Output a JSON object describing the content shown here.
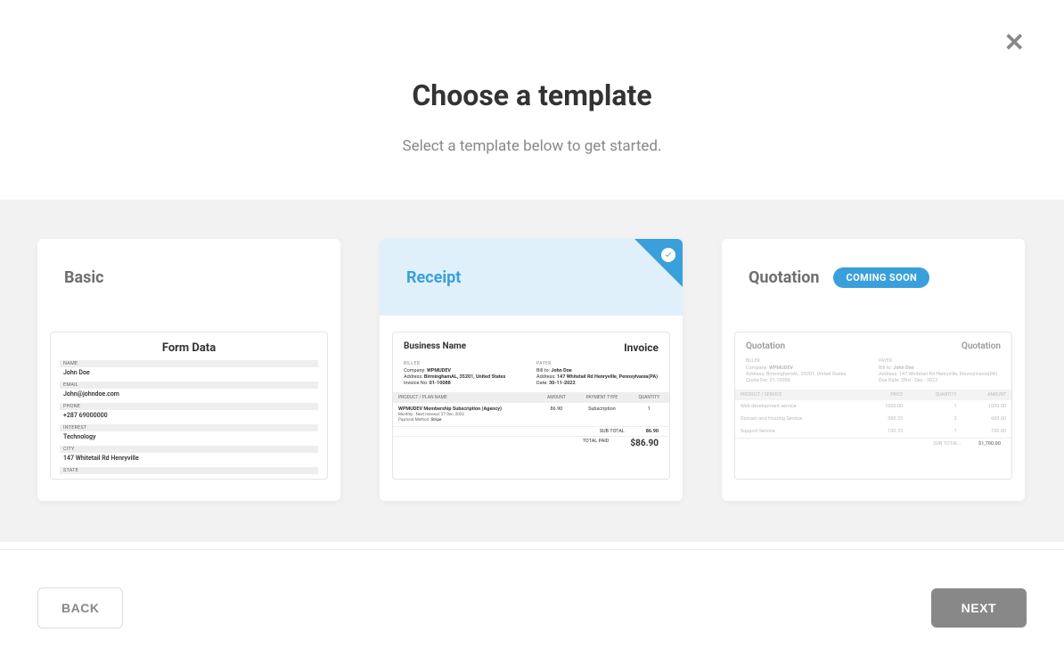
{
  "close": "✕",
  "header": {
    "title": "Choose a template",
    "subtitle": "Select a template below to get started."
  },
  "cards": {
    "basic": {
      "title": "Basic",
      "preview": {
        "heading": "Form Data",
        "fields": [
          {
            "label": "NAME",
            "value": "John Doe"
          },
          {
            "label": "EMAIL",
            "value": "John@johndoe.com"
          },
          {
            "label": "PHONE",
            "value": "+287 69000000"
          },
          {
            "label": "INTEREST",
            "value": "Technology"
          },
          {
            "label": "CITY",
            "value": "147 Whitetail Rd Henryville"
          },
          {
            "label": "STATE",
            "value": ""
          }
        ]
      }
    },
    "receipt": {
      "title": "Receipt",
      "selected": true,
      "preview": {
        "business": "Business Name",
        "invoice_label": "Invoice",
        "biller": {
          "title": "BILLER",
          "company_label": "Company:",
          "company": "WPMUDEV",
          "address_label": "Address:",
          "address": "BirminghamAL, 35201, United States",
          "invoice_no_label": "Invoice No:",
          "invoice_no": "01-10088"
        },
        "payer": {
          "title": "PAYER",
          "bill_to_label": "Bill to:",
          "bill_to": "John Doe",
          "address_label": "Address:",
          "address": "147 Whitetail Rd Henryville, Pennsylvania(PA)",
          "date_label": "Date:",
          "date": "30-11-2022"
        },
        "table": {
          "headers": [
            "PRODUCT / PLAN NAME",
            "AMOUNT",
            "PAYMENT TYPE",
            "QUANTITY"
          ],
          "row": {
            "product": "WPMUDEV Membership Subscription (Agency)",
            "sub1": "Monthly - Next renewal: 27 Dec, 2022",
            "sub2_label": "Payment Method:",
            "sub2_value": "Stripe",
            "amount": "86.90",
            "type": "Subscription",
            "qty": "1"
          }
        },
        "subtotal_label": "SUB TOTAL",
        "subtotal": "86.90",
        "total_label": "TOTAL PAID",
        "total": "$86.90"
      }
    },
    "quotation": {
      "title": "Quotation",
      "badge": "COMING SOON",
      "preview": {
        "left_head": "Quotation",
        "right_head": "Quotation",
        "biller": {
          "title": "BILLER",
          "company_label": "Company:",
          "company": "WPMUDEV",
          "address_label": "Address:",
          "address": "BirminghamAL, 35201, United States",
          "quote_for_label": "Quote For:",
          "quote_for": "01-10088"
        },
        "payer": {
          "title": "PAYER",
          "bill_to_label": "Bill to:",
          "bill_to": "John Doe",
          "address_label": "Address:",
          "address": "147 Whitetail Rd Henryville, Pennsylvania(PA)",
          "due_date_label": "Due Date:",
          "due_date": "28rd - Dec - 2022"
        },
        "table": {
          "headers": [
            "PRODUCT / SERVICE",
            "PRICE",
            "QUANTITY",
            "AMOUNT"
          ],
          "rows": [
            {
              "name": "Web development service",
              "price": "1000.00",
              "qty": "1",
              "amount": "1000.00"
            },
            {
              "name": "Domain and Hosting Service.",
              "price": "300.33",
              "qty": "2",
              "amount": "600.00"
            },
            {
              "name": "Support Service",
              "price": "100.33",
              "qty": "1",
              "amount": "100.00"
            }
          ]
        },
        "subtotal_label": "SUB TOTAL :",
        "subtotal": "$1,700.00"
      }
    }
  },
  "footer": {
    "back": "BACK",
    "next": "NEXT"
  }
}
